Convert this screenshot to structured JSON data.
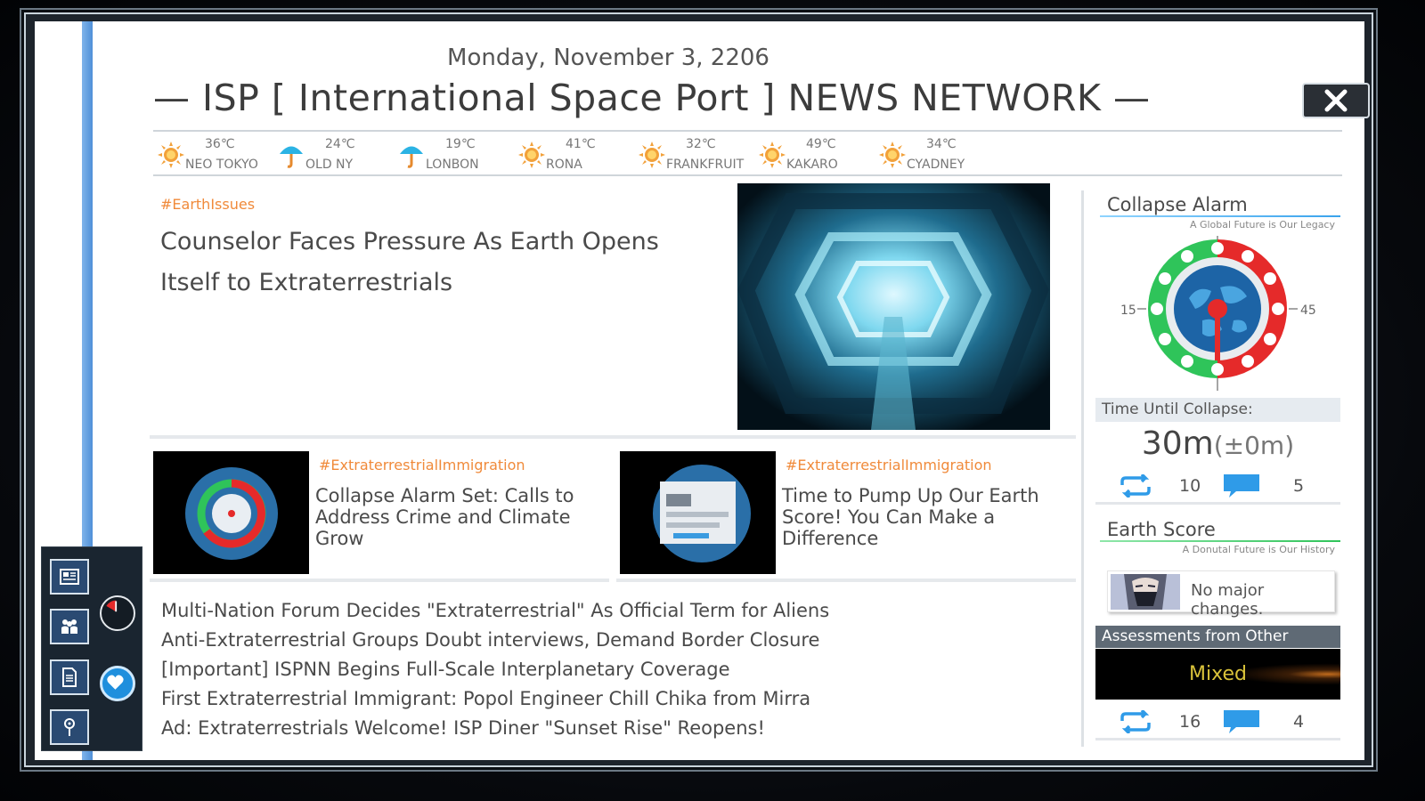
{
  "header": {
    "date": "Monday, November 3, 2206",
    "title": "— ISP [ International Space Port ] NEWS NETWORK —"
  },
  "weather": [
    {
      "icon": "sun-icon",
      "temp": "36℃",
      "city": "NEO TOKYO"
    },
    {
      "icon": "umbrella-icon",
      "temp": "24℃",
      "city": "OLD NY"
    },
    {
      "icon": "umbrella-icon",
      "temp": "19℃",
      "city": "LONBON"
    },
    {
      "icon": "sun-icon",
      "temp": "41℃",
      "city": "RONA"
    },
    {
      "icon": "sun-icon",
      "temp": "32℃",
      "city": "FRANKFRUIT"
    },
    {
      "icon": "sun-icon",
      "temp": "49℃",
      "city": "KAKARO"
    },
    {
      "icon": "sun-icon",
      "temp": "34℃",
      "city": "CYADNEY"
    }
  ],
  "main_story": {
    "tag": "#EarthIssues",
    "headline": "Counselor Faces Pressure As Earth Opens Itself to Extraterrestrials"
  },
  "cards": [
    {
      "tag": "#ExtraterrestrialImmigration",
      "headline": "Collapse Alarm Set: Calls to Address Crime and Climate Grow"
    },
    {
      "tag": "#ExtraterrestrialImmigration",
      "headline": "Time to Pump Up Our Earth Score! You Can Make a Difference"
    }
  ],
  "news_list": [
    "Multi-Nation Forum Decides \"Extraterrestrial\" As Official Term for Aliens",
    "Anti-Extraterrestrial Groups Doubt interviews, Demand Border Closure",
    "[Important] ISPNN Begins Full-Scale Interplanetary Coverage",
    "First Extraterrestrial Immigrant: Popol Engineer Chill Chika from Mirra",
    "Ad: Extraterrestrials Welcome! ISP Diner \"Sunset Rise\" Reopens!"
  ],
  "collapse_alarm": {
    "title": "Collapse Alarm",
    "subtitle": "A Global Future is Our Legacy",
    "gauge_left_label": "15",
    "gauge_right_label": "45",
    "time_label": "Time Until Collapse:",
    "time_value": "30m",
    "time_delta": "(±0m)",
    "reposts": "10",
    "comments": "5"
  },
  "earth_score": {
    "title": "Earth Score",
    "subtitle": "A Donutal Future is Our History",
    "status": "No major changes.",
    "assess_label": "Assessments from Other Planets",
    "assess_value": "Mixed",
    "reposts": "16",
    "comments": "4"
  },
  "colors": {
    "accent_orange": "#f08a3a",
    "accent_blue": "#2f9be8",
    "gauge_red": "#e52a2a",
    "gauge_green": "#2fc45a"
  },
  "dock_icons": [
    "newspaper-icon",
    "people-icon",
    "document-icon",
    "map-pin-icon",
    "clock-icon",
    "heart-icon"
  ]
}
